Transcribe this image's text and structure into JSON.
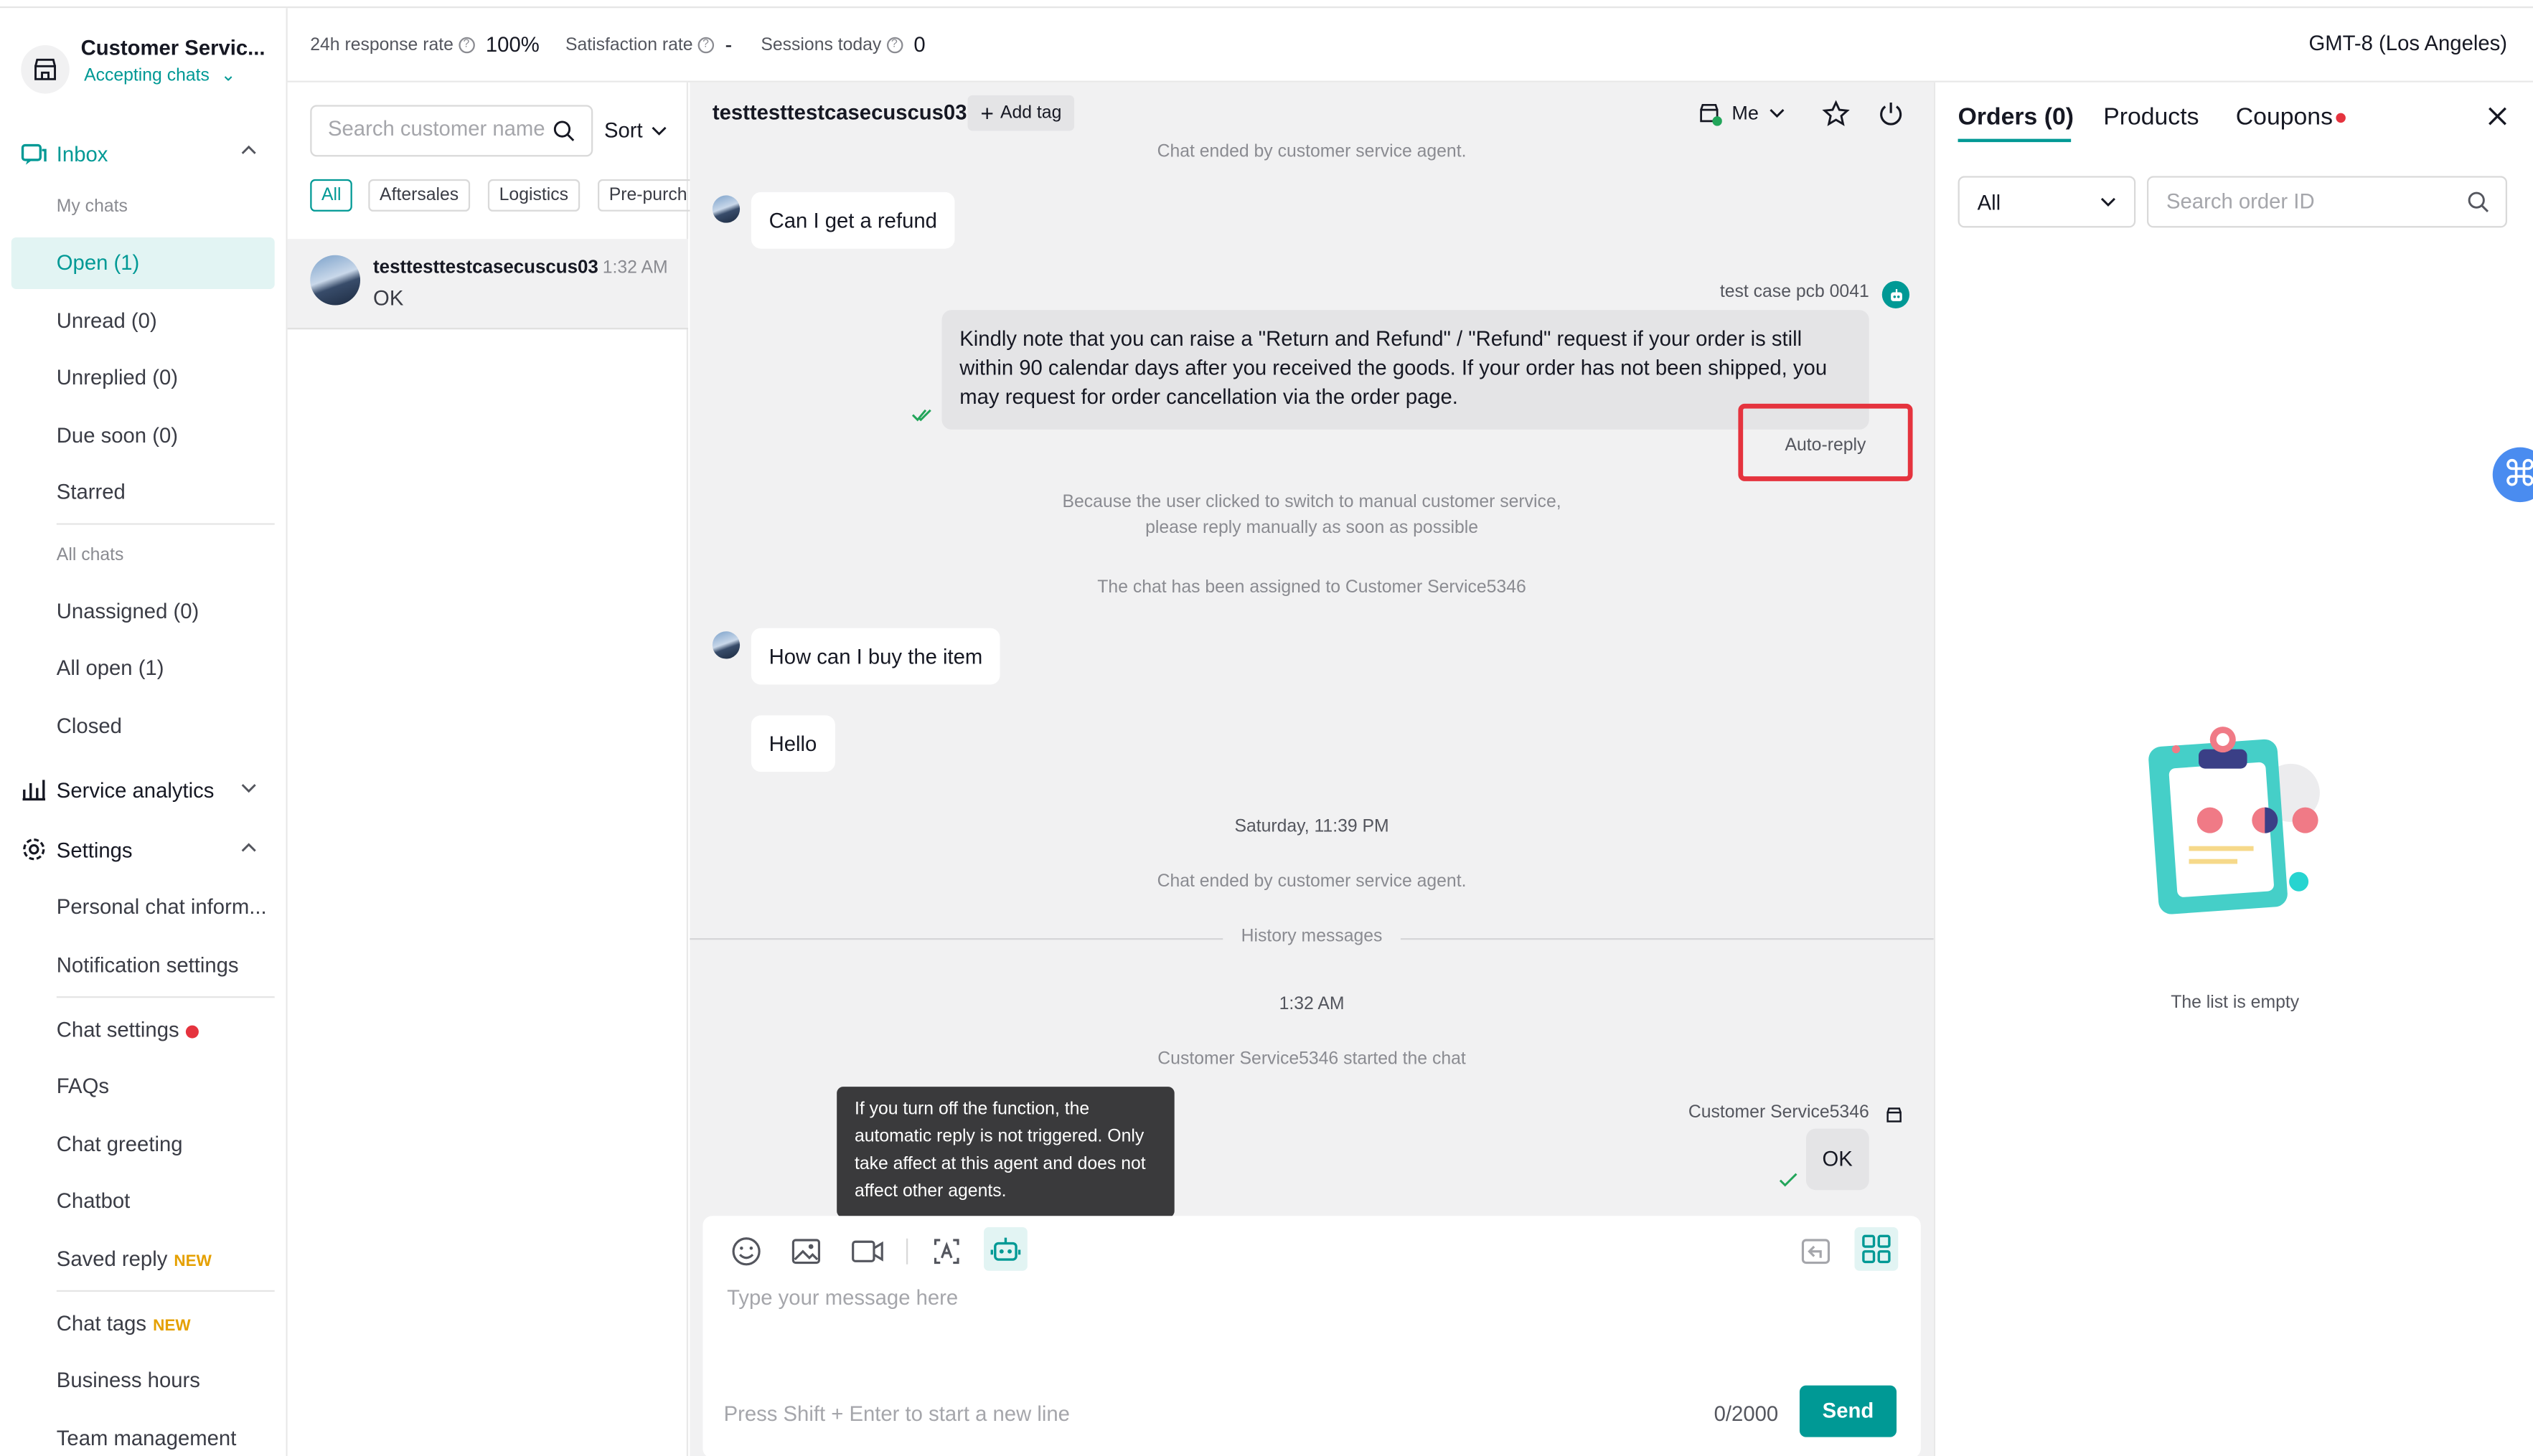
{
  "header": {
    "store_name": "Customer Servic...",
    "status": "Accepting chats",
    "stats": [
      {
        "label": "24h response rate",
        "value": "100%"
      },
      {
        "label": "Satisfaction rate",
        "value": "-"
      },
      {
        "label": "Sessions today",
        "value": "0"
      }
    ],
    "timezone": "GMT-8 (Los Angeles)"
  },
  "sidebar": {
    "inbox": "Inbox",
    "my_chats": "My chats",
    "items_my": [
      "Open (1)",
      "Unread (0)",
      "Unreplied (0)",
      "Due soon (0)",
      "Starred"
    ],
    "all_chats": "All chats",
    "items_all": [
      "Unassigned (0)",
      "All open (1)",
      "Closed"
    ],
    "service_analytics": "Service analytics",
    "settings": "Settings",
    "settings_items": {
      "personal": "Personal chat inform...",
      "notification": "Notification settings",
      "chat_settings": "Chat settings",
      "faqs": "FAQs",
      "greeting": "Chat greeting",
      "chatbot": "Chatbot",
      "saved_reply": "Saved reply",
      "chat_tags": "Chat tags",
      "business_hours": "Business hours",
      "team_management": "Team management"
    },
    "new_badge": "NEW"
  },
  "chat_list": {
    "search_placeholder": "Search customer name...",
    "sort": "Sort",
    "filters": [
      "All",
      "Aftersales",
      "Logistics",
      "Pre-purch"
    ],
    "conversation": {
      "name": "testtesttestcasecuscus03",
      "time": "1:32 AM",
      "preview": "OK"
    }
  },
  "chat": {
    "customer": "testtesttestcasecuscus03",
    "add_tag": "Add tag",
    "assignee": "Me",
    "messages": {
      "sys1": "Chat ended by customer service agent.",
      "in1": "Can I get a refund",
      "bot_sender": "test case pcb 0041",
      "bot_text_1": "Kindly note that you can raise a \"Return and Refund\" / \"Refund\" request if your order is still",
      "bot_text_2": "within 90 calendar days after you received the goods. If your order has not been shipped, you",
      "bot_text_3": "may request for order cancellation via the order page.",
      "auto_reply": "Auto-reply",
      "sys2_line1": "Because the user clicked to switch to manual customer service,",
      "sys2_line2": "please reply manually as soon as possible",
      "sys3": "The chat has been assigned to Customer Service5346",
      "in2": "How can I buy the item",
      "in3": "Hello",
      "date": "Saturday, 11:39 PM",
      "sys4": "Chat ended by customer service agent.",
      "history": "History messages",
      "time2": "1:32 AM",
      "sys5": "Customer Service5346 started the chat",
      "agent_sender": "Customer Service5346",
      "out_ok": "OK"
    },
    "tooltip": "If you turn off the function, the automatic reply is not triggered. Only take affect at this agent and does not affect other agents.",
    "composer": {
      "placeholder": "Type your message here",
      "hint": "Press Shift + Enter to start a new line",
      "counter": "0/2000",
      "send": "Send"
    }
  },
  "right_panel": {
    "tabs": [
      "Orders (0)",
      "Products",
      "Coupons"
    ],
    "filter": "All",
    "search_placeholder": "Search order ID",
    "empty_text": "The list is empty"
  },
  "colors": {
    "accent": "#009995",
    "highlight_box": "#e5333e"
  }
}
